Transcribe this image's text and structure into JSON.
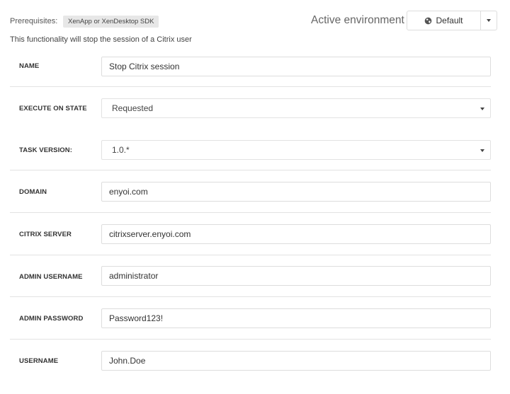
{
  "header": {
    "prerequisites_label": "Prerequisites:",
    "prerequisite_badge": "XenApp or XenDesktop SDK",
    "description": "This functionality will stop the session of a Citrix user",
    "environment_label": "Active environment",
    "environment_value": "Default",
    "environment_icon": "globe-icon"
  },
  "fields": {
    "name": {
      "label": "NAME",
      "value": "Stop Citrix session"
    },
    "execute_on_state": {
      "label": "EXECUTE ON STATE",
      "value": "Requested"
    },
    "task_version": {
      "label": "TASK VERSION:",
      "value": "1.0.*"
    },
    "domain": {
      "label": "DOMAIN",
      "value": "enyoi.com"
    },
    "citrix_server": {
      "label": "CITRIX SERVER",
      "value": "citrixserver.enyoi.com"
    },
    "admin_username": {
      "label": "ADMIN USERNAME",
      "value": "administrator"
    },
    "admin_password": {
      "label": "ADMIN PASSWORD",
      "value": "Password123!"
    },
    "username": {
      "label": "USERNAME",
      "value": "John.Doe"
    }
  },
  "colors": {
    "border": "#dddddd",
    "separator": "#e2e2e2",
    "badge_bg": "#e7e7e7",
    "text": "#333333"
  }
}
